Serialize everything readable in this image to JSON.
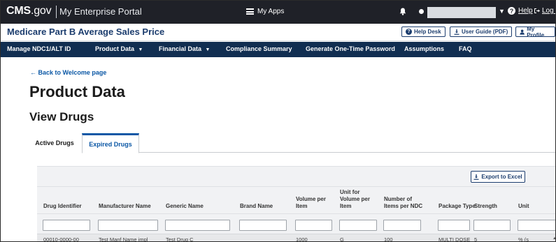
{
  "topbar": {
    "brand_bold": "CMS",
    "brand_rest": ".gov",
    "portal": "My Enterprise Portal",
    "apps_label": "My Apps",
    "help_label": "Help",
    "logout_label": "Log O"
  },
  "app_header": {
    "title": "Medicare Part B Average Sales Price",
    "help_desk": "Help Desk",
    "user_guide": "User Guide (PDF)",
    "my_profile": "My Profile"
  },
  "nav": {
    "items": [
      "Manage NDC1/ALT ID",
      "Product Data",
      "Financial Data",
      "Compliance Summary",
      "Generate One-Time Password",
      "Assumptions",
      "FAQ"
    ]
  },
  "page": {
    "back_link": "← Back to Welcome page",
    "title": "Product Data",
    "subtitle": "View Drugs"
  },
  "tabs": [
    "Active Drugs",
    "Expired Drugs"
  ],
  "table": {
    "export_label": "Export to Excel",
    "columns": [
      [
        "Drug Identifier"
      ],
      [
        "Manufacturer Name"
      ],
      [
        "Generic Name"
      ],
      [
        "Brand Name"
      ],
      [
        "Volume per",
        "Item"
      ],
      [
        "Unit for",
        "Volume per",
        "Item"
      ],
      [
        "Number of",
        "Items per NDC"
      ],
      [
        "Package Type"
      ],
      [
        "Strength"
      ],
      [
        "Unit"
      ]
    ],
    "rows": [
      [
        "00010-0000-00",
        "Test Manf Name impl",
        "Test Drug C",
        "",
        "1000",
        "G",
        "100",
        "MULTI DOSE",
        "5",
        "% (s"
      ]
    ]
  },
  "colors": {
    "topbar": "#1f2128",
    "nav": "#112e51",
    "title_blue": "#1c3d6e",
    "link_blue": "#0a57a5"
  }
}
